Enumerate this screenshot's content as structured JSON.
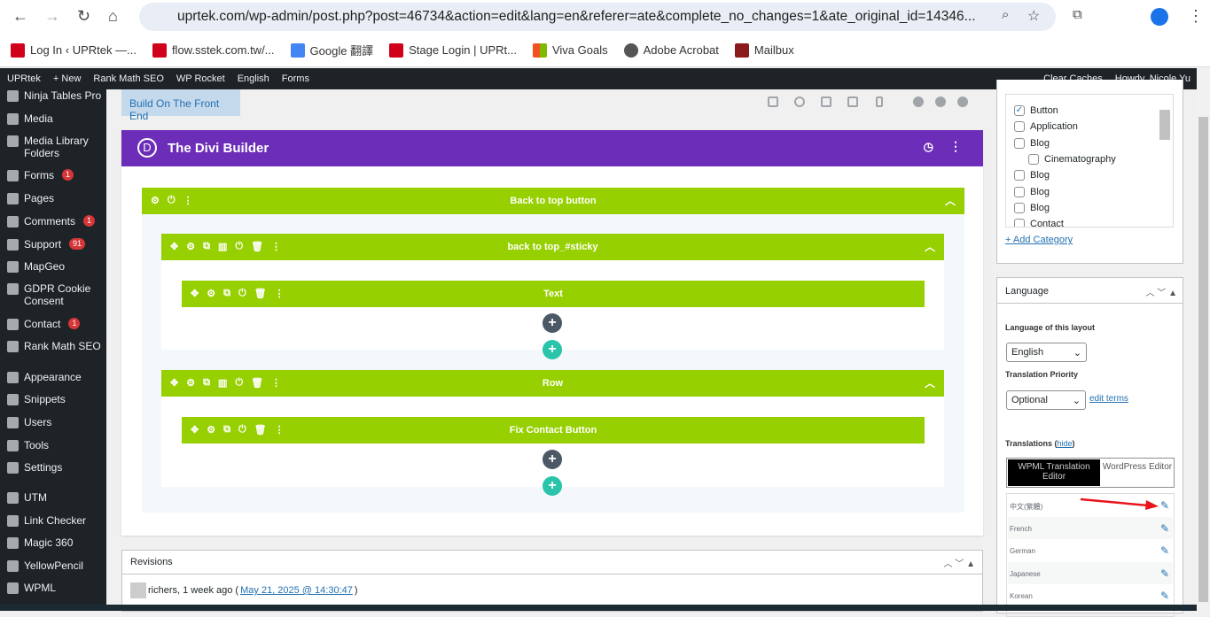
{
  "browser": {
    "url": "uprtek.com/wp-admin/post.php?post=46734&action=edit&lang=en&referer=ate&complete_no_changes=1&ate_original_id=14346...",
    "bookmarks": [
      {
        "label": "Log In ‹ UPRtek —...",
        "color": "#d0021b"
      },
      {
        "label": "flow.sstek.com.tw/...",
        "color": "#d0021b"
      },
      {
        "label": "Google 翻譯",
        "color": "#4285f4"
      },
      {
        "label": "Stage Login | UPRt...",
        "color": "#d0021b"
      },
      {
        "label": "Viva Goals",
        "color": "#f25022"
      },
      {
        "label": "Adobe Acrobat",
        "color": "#555555"
      },
      {
        "label": "Mailbux",
        "color": "#8b1a1a"
      }
    ]
  },
  "adminbar": {
    "items": [
      "UPRtek",
      "+ New",
      "Rank Math SEO",
      "WP Rocket",
      "English",
      "Forms"
    ],
    "clear_caches": "Clear Caches",
    "howdy": "Howdy, Nicole Yu"
  },
  "sidebar": {
    "items": [
      {
        "label": "Ninja Tables Pro"
      },
      {
        "label": "Media"
      },
      {
        "label": "Media Library Folders"
      },
      {
        "label": "Forms",
        "badge": "1"
      },
      {
        "label": "Pages"
      },
      {
        "label": "Comments",
        "badge": "1"
      },
      {
        "label": "Support",
        "badge": "91"
      },
      {
        "label": "MapGeo"
      },
      {
        "label": "GDPR Cookie Consent"
      },
      {
        "label": "Contact",
        "badge": "1"
      },
      {
        "label": "Rank Math SEO"
      },
      {
        "label": "Appearance"
      },
      {
        "label": "Snippets"
      },
      {
        "label": "Users"
      },
      {
        "label": "Tools"
      },
      {
        "label": "Settings"
      },
      {
        "label": "UTM"
      },
      {
        "label": "Link Checker"
      },
      {
        "label": "Magic 360"
      },
      {
        "label": "YellowPencil"
      },
      {
        "label": "WPML"
      }
    ]
  },
  "builder": {
    "front_end_button": "Build On The Front End",
    "title": "The Divi Builder",
    "logo": "D",
    "section": "Back to top button",
    "rows": [
      {
        "label": "back to top_#sticky",
        "module": "Text"
      },
      {
        "label": "Row",
        "module": "Fix Contact Button"
      }
    ]
  },
  "revisions": {
    "title": "Revisions",
    "entry_text": "richers, 1 week ago (",
    "entry_link": "May 21, 2025 @ 14:30:47",
    "entry_close": ")"
  },
  "categories": {
    "items": [
      {
        "label": "Button",
        "checked": true
      },
      {
        "label": "Application"
      },
      {
        "label": "Blog"
      },
      {
        "label": "Cinematography",
        "child": true
      },
      {
        "label": "Blog"
      },
      {
        "label": "Blog"
      },
      {
        "label": "Blog"
      },
      {
        "label": "Contact"
      }
    ],
    "add_link": "+ Add Category"
  },
  "language": {
    "title": "Language",
    "layout_label": "Language of this layout",
    "layout_value": "English",
    "priority_label": "Translation Priority",
    "priority_value": "Optional",
    "edit_terms": "edit terms",
    "translations_label": "Translations",
    "hide": "hide",
    "tab_wpml": "WPML Translation Editor",
    "tab_wp": "WordPress Editor",
    "translations": [
      "中文(繁體)",
      "French",
      "German",
      "Japanese",
      "Korean"
    ]
  },
  "colors": {
    "divi_purple": "#6c2eb9",
    "green": "#97d000",
    "annotation_arrow": "#e8141b"
  }
}
